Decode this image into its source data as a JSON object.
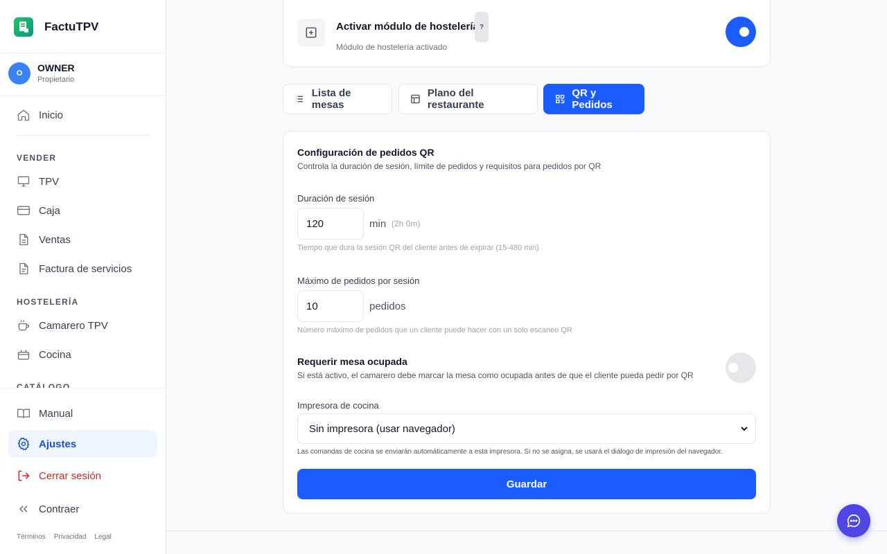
{
  "app": {
    "name": "FactuTPV"
  },
  "user": {
    "initial": "O",
    "name": "OWNER",
    "role": "Propietario"
  },
  "nav": {
    "home": "Inicio",
    "sell_section": "VENDER",
    "tpv": "TPV",
    "caja": "Caja",
    "ventas": "Ventas",
    "factura": "Factura de servicios",
    "hospitality_section": "HOSTELERÍA",
    "camarero": "Camarero TPV",
    "cocina": "Cocina",
    "catalog_section": "CATÁLOGO",
    "manual": "Manual",
    "ajustes": "Ajustes",
    "logout": "Cerrar sesión",
    "collapse": "Contraer"
  },
  "footer_links": [
    "Términos",
    "Privacidad",
    "Legal"
  ],
  "module": {
    "title": "Activar módulo de hostelería",
    "help": "?",
    "status": "Módulo de hostelería activado",
    "enabled": true
  },
  "tabs": [
    {
      "label": "Lista de mesas",
      "active": false
    },
    {
      "label": "Plano del restaurante",
      "active": false
    },
    {
      "label": "QR y Pedidos",
      "active": true
    }
  ],
  "qr_config": {
    "title": "Configuración de pedidos QR",
    "subtitle": "Controla la duración de sesión, límite de pedidos y requisitos para pedidos por QR",
    "session": {
      "label": "Duración de sesión",
      "value": "120",
      "unit": "min",
      "unit_detail": "(2h 0m)",
      "hint": "Tiempo que dura la sesión QR del cliente antes de expirar (15-480 min)"
    },
    "max_orders": {
      "label": "Máximo de pedidos por sesión",
      "value": "10",
      "unit": "pedidos",
      "hint": "Número máximo de pedidos que un cliente puede hacer con un solo escaneo QR"
    },
    "require_table": {
      "title": "Requerir mesa ocupada",
      "description": "Si está activo, el camarero debe marcar la mesa como ocupada antes de que el cliente pueda pedir por QR",
      "enabled": false
    },
    "printer": {
      "label": "Impresora de cocina",
      "selected": "Sin impresora (usar navegador)",
      "hint": "Las comandas de cocina se enviarán automáticamente a esta impresora. Si no se asigna, se usará el diálogo de impresión del navegador."
    },
    "save_label": "Guardar"
  },
  "colors": {
    "primary": "#1a5cff",
    "danger": "#dc2626",
    "chat": "#4f46e5"
  }
}
